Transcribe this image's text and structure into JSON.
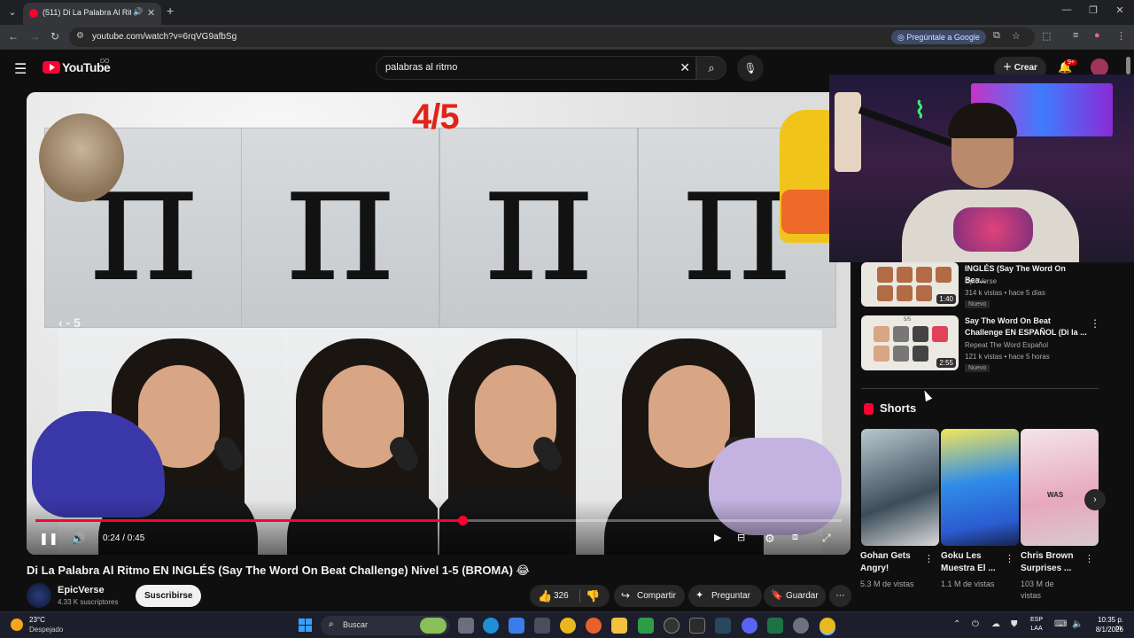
{
  "browser": {
    "tab_title": "(511) Di La Palabra Al Ritmo",
    "url": "youtube.com/watch?v=6rqVG9afbSg",
    "ask_google": "Pregúntale a Google"
  },
  "yt": {
    "wordmark": "YouTube",
    "country": "DO",
    "search_query": "palabras al ritmo",
    "create_label": "Crear",
    "notif_count": "9+"
  },
  "player": {
    "overlay_counter": "4/5",
    "skip_back_label": "- 5",
    "time": "0:24 / 0:45",
    "progress": 0.53
  },
  "video": {
    "title": "Di La Palabra Al Ritmo EN INGLÉS (Say The Word On Beat Challenge) Nivel 1-5 (BROMA) 😂",
    "channel": "EpicVerse",
    "subscribers": "4.33 K suscriptores",
    "subscribe_label": "Suscribirse",
    "likes": "326",
    "share_label": "Compartir",
    "ask_label": "Preguntar",
    "save_label": "Guardar"
  },
  "sidebar": {
    "items": [
      {
        "title": "INGLÉS (Say The Word On Bea...",
        "channel": "EpicVerse",
        "meta": "314 k vistas • hace 5 días",
        "badge": "Nuevo",
        "duration": "1:40"
      },
      {
        "title": "Say The Word On Beat Challenge EN ESPAÑOL (Di la ...",
        "channel": "Repeat The Word Español",
        "meta": "121 k vistas • hace 5 horas",
        "badge": "Nuevo",
        "duration": "2:55",
        "thumb_label": "5/5"
      }
    ],
    "shorts_label": "Shorts",
    "shorts": [
      {
        "title": "Gohan Gets Angry!",
        "views": "5.3 M de vistas"
      },
      {
        "title": "Goku Les Muestra El ...",
        "views": "1.1 M de vistas"
      },
      {
        "title": "Chris Brown Surprises ...",
        "views": "103 M de vistas",
        "thumb_text": "WAS"
      }
    ]
  },
  "taskbar": {
    "weather_temp": "23°C",
    "weather_desc": "Despejado",
    "search_label": "Buscar",
    "lang_1": "ESP",
    "lang_2": "LAA",
    "time": "10:35 p. m.",
    "date": "8/1/2026"
  }
}
